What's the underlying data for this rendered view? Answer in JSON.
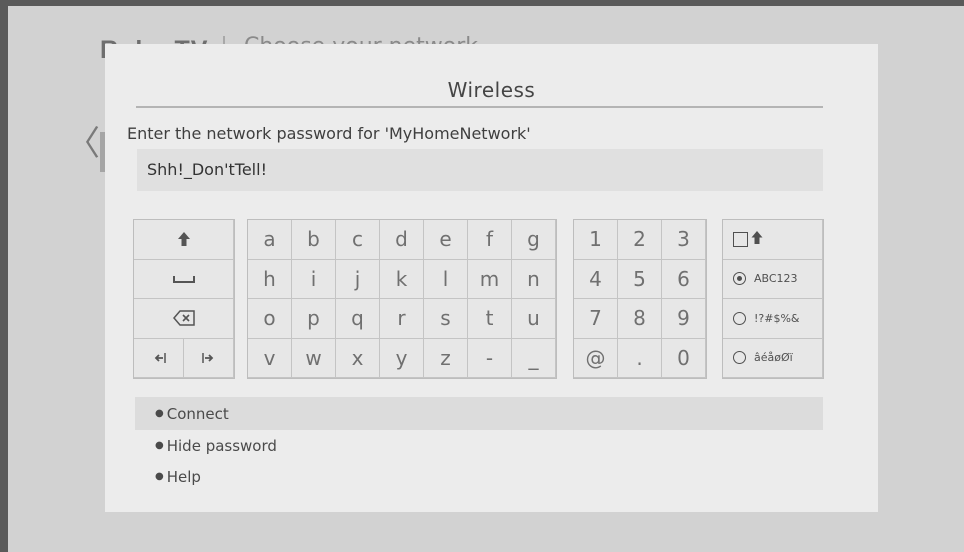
{
  "header": {
    "logo": "Roku TV",
    "title": "Choose your network"
  },
  "background": {
    "back_icon": "chevron-left"
  },
  "dialog": {
    "title": "Wireless",
    "prompt": "Enter the network password for 'MyHomeNetwork'",
    "password_value": "Shh!_Don'tTell!"
  },
  "keyboard": {
    "function_keys": {
      "shift": "shift-icon",
      "space": "space-icon",
      "backspace": "backspace-icon",
      "cursor_left": "cursor-left-icon",
      "cursor_right": "cursor-right-icon"
    },
    "letters": [
      "a",
      "b",
      "c",
      "d",
      "e",
      "f",
      "g",
      "h",
      "i",
      "j",
      "k",
      "l",
      "m",
      "n",
      "o",
      "p",
      "q",
      "r",
      "s",
      "t",
      "u",
      "v",
      "w",
      "x",
      "y",
      "z",
      "-",
      "_"
    ],
    "digits": [
      "1",
      "2",
      "3",
      "4",
      "5",
      "6",
      "7",
      "8",
      "9",
      "@",
      ".",
      "0"
    ],
    "modes": {
      "caps_lock": "caps-lock-icon",
      "options": [
        {
          "label": "ABC123",
          "selected": true
        },
        {
          "label": "!?#$%&",
          "selected": false
        },
        {
          "label": "âéåøØï",
          "selected": false
        }
      ]
    }
  },
  "menu": {
    "items": [
      {
        "label": "Connect",
        "selected": true
      },
      {
        "label": "Hide password",
        "selected": false
      },
      {
        "label": "Help",
        "selected": false
      }
    ]
  },
  "colors": {
    "dialog_bg": "#ececec",
    "screen_bg": "#d2d2d2",
    "selected_row": "#dcdcdc"
  }
}
